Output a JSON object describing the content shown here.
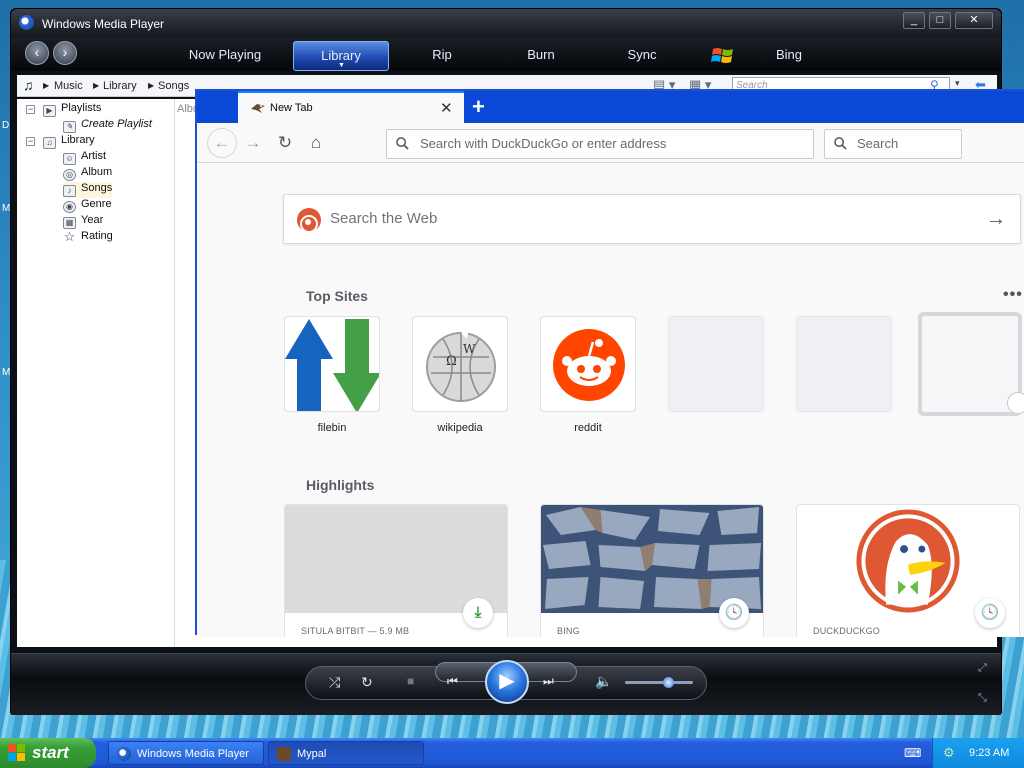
{
  "wmp": {
    "title": "Windows Media Player",
    "tabs": [
      "Now Playing",
      "Library",
      "Rip",
      "Burn",
      "Sync",
      "Bing"
    ],
    "breadcrumb": [
      "Music",
      "Library",
      "Songs"
    ],
    "search_placeholder": "Search",
    "tree": {
      "playlists": "Playlists",
      "create_playlist": "Create Playlist",
      "library": "Library",
      "items": [
        "Artist",
        "Album",
        "Songs",
        "Genre",
        "Year",
        "Rating"
      ]
    },
    "column_partial": "Albu"
  },
  "firefox": {
    "tab_title": "New Tab",
    "url_placeholder": "Search with DuckDuckGo or enter address",
    "search_placeholder": "Search",
    "page_search_placeholder": "Search the Web",
    "top_sites_title": "Top Sites",
    "top_sites": [
      {
        "label": "filebin"
      },
      {
        "label": "wikipedia"
      },
      {
        "label": "reddit"
      }
    ],
    "highlights_title": "Highlights",
    "highlights": [
      {
        "source": "SITULA BITBIT — 5.9 MB",
        "badge": "download-icon"
      },
      {
        "source": "BING",
        "badge": "clock-icon"
      },
      {
        "source": "DUCKDUCKGO",
        "badge": "clock-icon"
      }
    ]
  },
  "taskbar": {
    "start_label": "start",
    "items": [
      "Windows Media Player",
      "Mypal"
    ],
    "clock": "9:23 AM"
  },
  "colors": {
    "firefox_accent": "#0a84ff",
    "ddg_orange": "#de5833",
    "reddit_orange": "#ff4500",
    "wmp_active_tab": "#1c46b0",
    "xp_taskbar": "#245edb",
    "xp_start_green": "#38a038"
  }
}
